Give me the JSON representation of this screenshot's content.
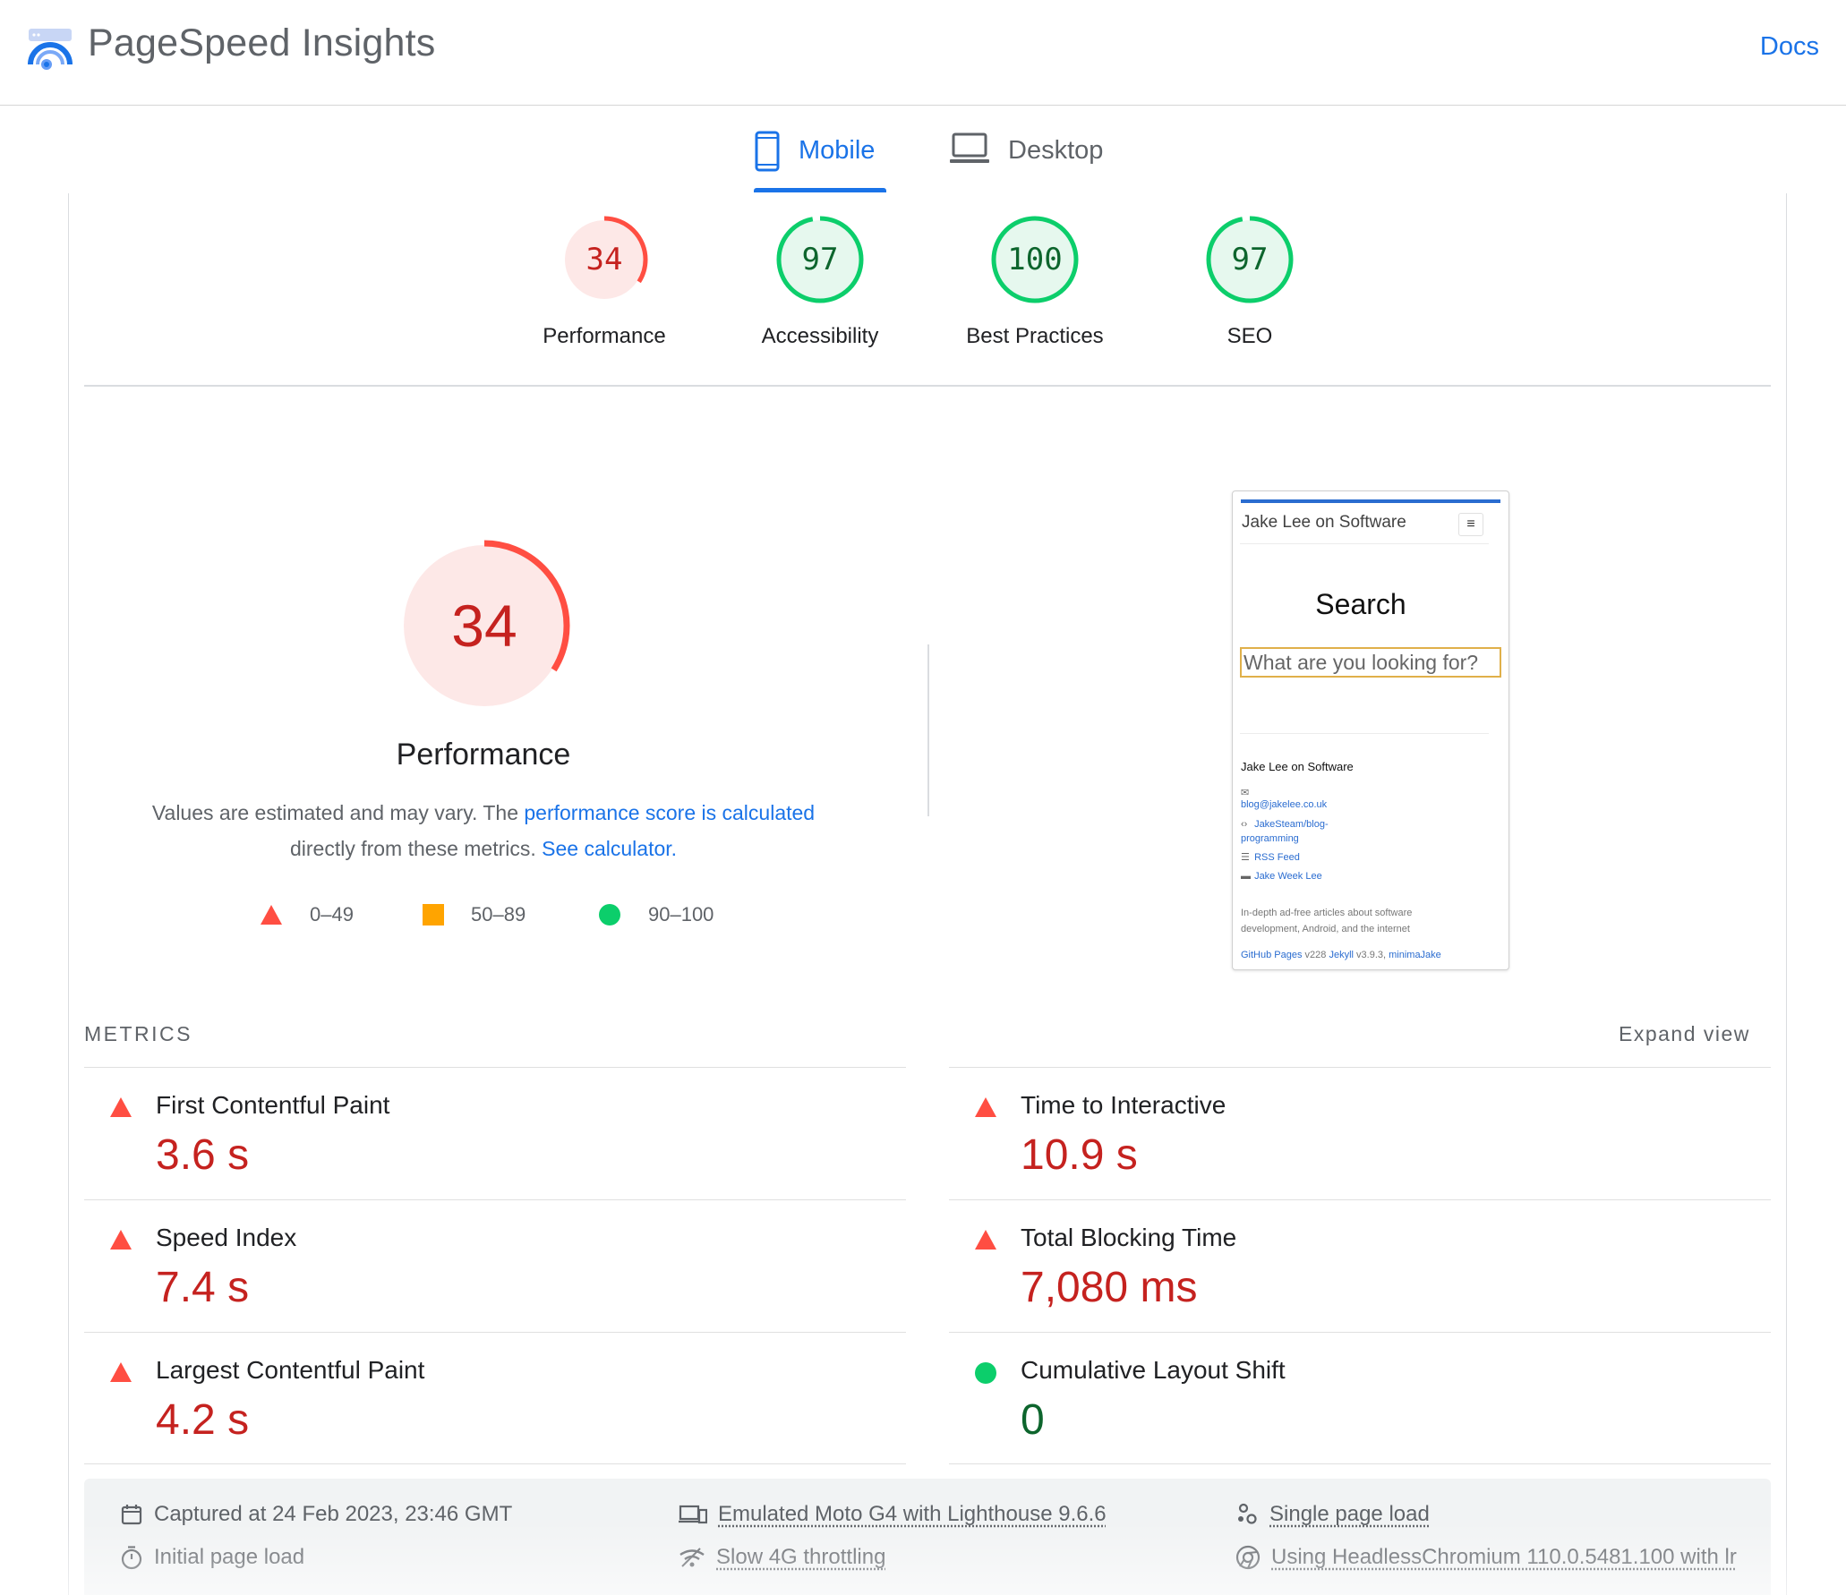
{
  "header": {
    "title": "PageSpeed Insights",
    "docs_label": "Docs"
  },
  "tabs": [
    {
      "label": "Mobile",
      "active": true
    },
    {
      "label": "Desktop",
      "active": false
    }
  ],
  "categories": [
    {
      "label": "Performance",
      "score": "34",
      "status": "fail"
    },
    {
      "label": "Accessibility",
      "score": "97",
      "status": "pass"
    },
    {
      "label": "Best Practices",
      "score": "100",
      "status": "pass"
    },
    {
      "label": "SEO",
      "score": "97",
      "status": "pass"
    }
  ],
  "performance": {
    "score": "34",
    "title": "Performance",
    "desc_prefix": "Values are estimated and may vary. The ",
    "desc_link1": "performance score is calculated",
    "desc_middle": " directly from these metrics. ",
    "desc_link2": "See calculator."
  },
  "legend": {
    "fail": "0–49",
    "average": "50–89",
    "pass": "90–100"
  },
  "screenshot": {
    "site_title": "Jake Lee on Software",
    "menu_icon": "hamburger-icon",
    "search_heading": "Search",
    "search_placeholder": "What are you looking for?",
    "footer_title": "Jake Lee on Software",
    "links": [
      {
        "icon": "mail-icon",
        "text": "blog@jakelee.co.uk"
      },
      {
        "icon": "code-icon",
        "text": "JakeSteam/blog-"
      },
      {
        "icon": "",
        "text": "programming"
      },
      {
        "icon": "rss-icon",
        "text": "RSS Feed"
      },
      {
        "icon": "bookmark-icon",
        "text": "Jake Week Lee"
      }
    ],
    "description_line1": "In-depth ad-free articles about software",
    "description_line2": "development, Android, and the internet",
    "credit": {
      "github": "GitHub Pages",
      "version": " v228 ",
      "jekyll": "Jekyll",
      "jekyll_version": " v3.9.3, ",
      "theme": "minimaJake"
    }
  },
  "metrics": {
    "title": "METRICS",
    "expand_label": "Expand view",
    "items": [
      {
        "name": "First Contentful Paint",
        "value": "3.6 s",
        "status": "fail"
      },
      {
        "name": "Time to Interactive",
        "value": "10.9 s",
        "status": "fail"
      },
      {
        "name": "Speed Index",
        "value": "7.4 s",
        "status": "fail"
      },
      {
        "name": "Total Blocking Time",
        "value": "7,080 ms",
        "status": "fail"
      },
      {
        "name": "Largest Contentful Paint",
        "value": "4.2 s",
        "status": "fail"
      },
      {
        "name": "Cumulative Layout Shift",
        "value": "0",
        "status": "pass"
      }
    ]
  },
  "runtime": {
    "captured": "Captured at 24 Feb 2023, 23:46 GMT",
    "initial_load": "Initial page load",
    "device": "Emulated Moto G4 with Lighthouse 9.6.6",
    "throttling": "Slow 4G throttling",
    "session": "Single page load",
    "browser": "Using HeadlessChromium 110.0.5481.100 with lr"
  },
  "colors": {
    "accent": "#1a73e8",
    "fail": "#c5221f",
    "fail_ring": "#ff4e42",
    "fail_bg": "#fde8e7",
    "average": "#ffa400",
    "pass": "#0cce6b",
    "pass_text": "#0d652d"
  }
}
